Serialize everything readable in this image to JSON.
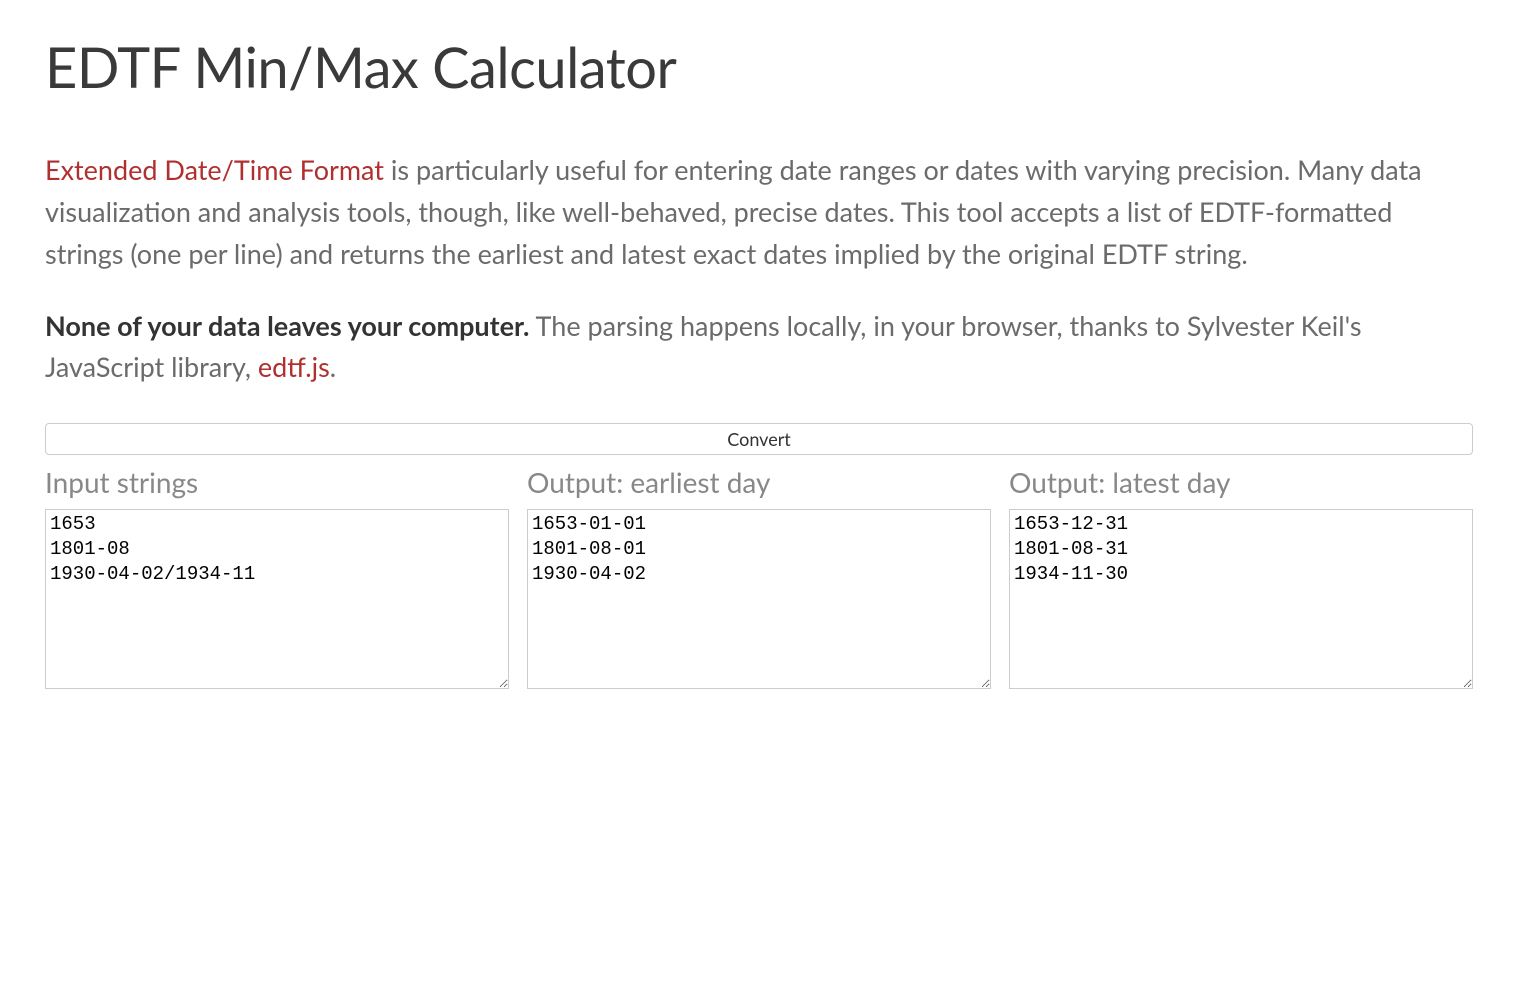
{
  "title": "EDTF Min/Max Calculator",
  "intro": {
    "link_text": "Extended Date/Time Format",
    "body": " is particularly useful for entering date ranges or dates with varying precision. Many data visualization and analysis tools, though, like well-behaved, precise dates. This tool accepts a list of EDTF-formatted strings (one per line) and returns the earliest and latest exact dates implied by the original EDTF string."
  },
  "privacy": {
    "bold": "None of your data leaves your computer.",
    "body": " The parsing happens locally, in your browser, thanks to Sylvester Keil's JavaScript library, ",
    "link_text": "edtf.js",
    "after": "."
  },
  "convert_label": "Convert",
  "columns": {
    "input": {
      "header": "Input strings",
      "value": "1653\n1801-08\n1930-04-02/1934-11"
    },
    "earliest": {
      "header": "Output: earliest day",
      "value": "1653-01-01\n1801-08-01\n1930-04-02"
    },
    "latest": {
      "header": "Output: latest day",
      "value": "1653-12-31\n1801-08-31\n1934-11-30"
    }
  }
}
